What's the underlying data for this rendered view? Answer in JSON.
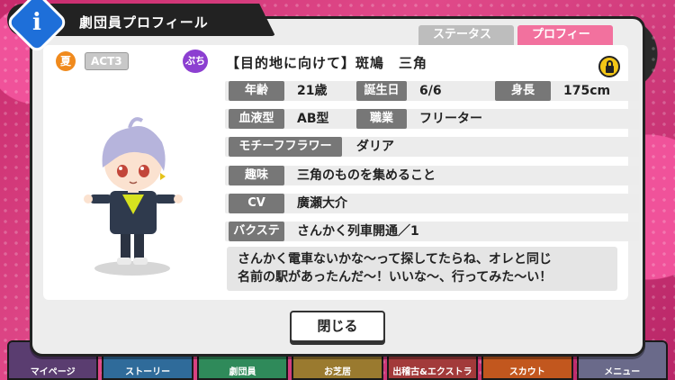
{
  "header": {
    "title": "劇団員プロフィール"
  },
  "tabs": [
    {
      "label": "ステータス",
      "active": false
    },
    {
      "label": "プロフィール",
      "active": true
    }
  ],
  "badges": {
    "season": "夏",
    "act": "ACT3",
    "troupe": "ぷち"
  },
  "card_name": "【目的地に向けて】斑鳩　三角",
  "profile": {
    "age_label": "年齢",
    "age": "21歳",
    "birthday_label": "誕生日",
    "birthday": "6/6",
    "height_label": "身長",
    "height": "175cm",
    "blood_label": "血液型",
    "blood": "AB型",
    "job_label": "職業",
    "job": "フリーター",
    "flower_label": "モチーフフラワー",
    "flower": "ダリア",
    "hobby_label": "趣味",
    "hobby": "三角のものを集めること",
    "cv_label": "CV",
    "cv": "廣瀬大介",
    "backstage_label": "バクステ",
    "backstage": "さんかく列車開通／1"
  },
  "quote": {
    "line1": "さんかく電車ないかな～って探してたらね、オレと同じ",
    "line2": "名前の駅があったんだ～！いいな～、行ってみた～い！"
  },
  "close_label": "閉じる",
  "bottom_nav": [
    "マイページ",
    "ストーリー",
    "劇団員",
    "お芝居",
    "出稽古&エクストラ",
    "スカウト",
    "メニュー"
  ],
  "colors": {
    "accent_pink": "#f2719e",
    "info_blue": "#1e6fd9",
    "lock_yellow": "#f3c616",
    "troupe_purple": "#8c3fd1",
    "season_orange": "#f08a1d"
  }
}
